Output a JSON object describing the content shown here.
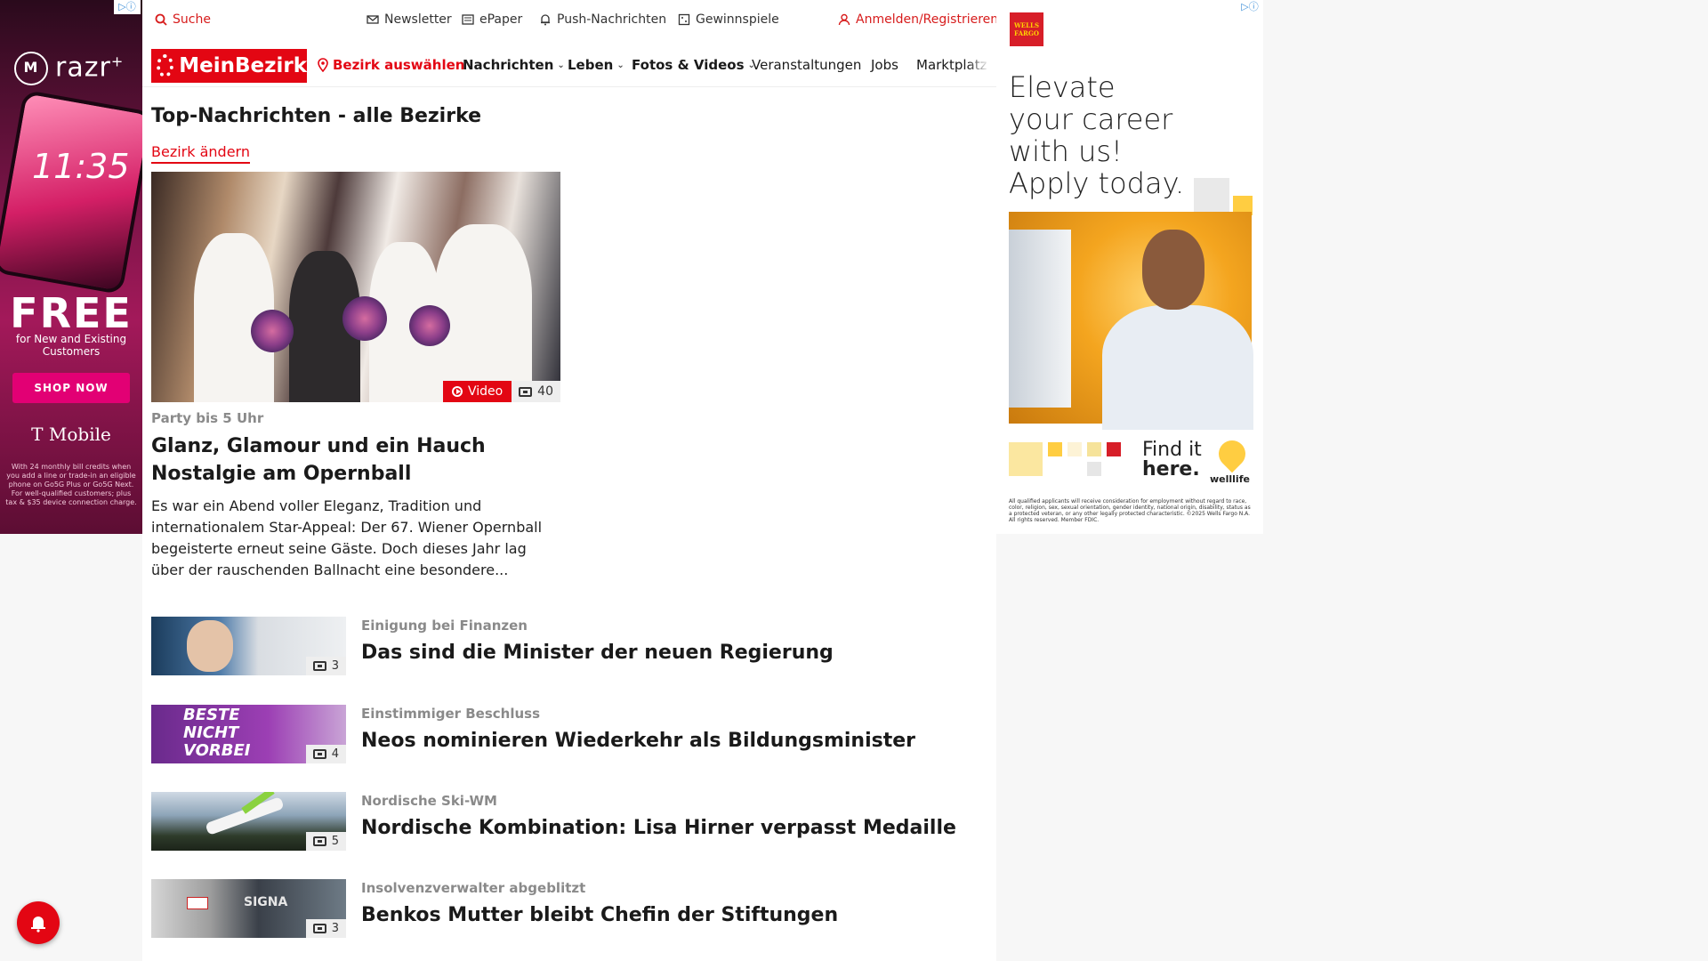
{
  "left_ad": {
    "brand": "razr",
    "brand_sup": "+",
    "clock": "11:35",
    "free": "FREE",
    "free_sub": "for New and Existing Customers",
    "cta": "SHOP NOW",
    "advertiser": "T Mobile",
    "fine_print": "With 24 monthly bill credits when you add a line or trade-in an eligible phone on Go5G Plus or Go5G Next. For well-qualified customers; plus tax & $35 device connection charge."
  },
  "topbar": {
    "search": "Suche",
    "newsletter": "Newsletter",
    "epaper": "ePaper",
    "push": "Push-Nachrichten",
    "gewinnspiele": "Gewinnspiele",
    "login": "Anmelden/Registrieren"
  },
  "nav": {
    "logo": "MeinBezirk",
    "bezirk": "Bezirk auswählen",
    "items": [
      "Nachrichten",
      "Leben",
      "Fotos & Videos",
      "Veranstaltungen",
      "Jobs",
      "Marktplatz"
    ]
  },
  "section": {
    "title": "Top-Nachrichten - alle Bezirke",
    "change_link": "Bezirk ändern"
  },
  "hero": {
    "video_label": "Video",
    "image_count": "40",
    "kicker": "Party bis 5 Uhr",
    "title": "Glanz, Glamour und ein Hauch Nostalgie am Opernball",
    "teaser": "Es war ein Abend voller Eleganz, Tradition und internationalem Star-Appeal: Der 67. Wiener Opernball begeisterte erneut seine Gäste. Doch dieses Jahr lag über der rauschenden Ballnacht eine besondere..."
  },
  "articles": [
    {
      "kicker": "Einigung bei Finanzen",
      "title": "Das sind die Minister der neuen Regierung",
      "count": "3"
    },
    {
      "kicker": "Einstimmiger Beschluss",
      "title": "Neos nominieren Wiederkehr als Bildungsminister",
      "count": "4",
      "thumb_text": "BESTE NICHT VORBEI"
    },
    {
      "kicker": "Nordische Ski-WM",
      "title": "Nordische Kombination: Lisa Hirner verpasst Medaille",
      "count": "5"
    },
    {
      "kicker": "Insolvenzverwalter abgeblitzt",
      "title": "Benkos Mutter bleibt Chefin der Stiftungen",
      "count": "3",
      "thumb_text": "SIGNA"
    }
  ],
  "right_ad": {
    "logo": "WELLS FARGO",
    "headline": [
      "Elevate",
      "your career",
      "with us!",
      "Apply today."
    ],
    "find_it": "Find it",
    "here": "here.",
    "welllife": "welllife",
    "fine_print": "All qualified applicants will receive consideration for employment without regard to race, color, religion, sex, sexual orientation, gender identity, national origin, disability, status as a protected veteran, or any other legally protected characteristic. ©2025 Wells Fargo N.A. All rights reserved. Member FDIC."
  },
  "colors": {
    "brand_red": "#e30613",
    "tmobile_magenta": "#e20074",
    "wells_red": "#d71e28"
  },
  "icons": [
    "search-icon",
    "mail-icon",
    "newspaper-icon",
    "bell-icon",
    "gift-icon",
    "user-icon",
    "location-pin-icon",
    "chevron-down-icon",
    "play-icon",
    "camera-icon"
  ]
}
